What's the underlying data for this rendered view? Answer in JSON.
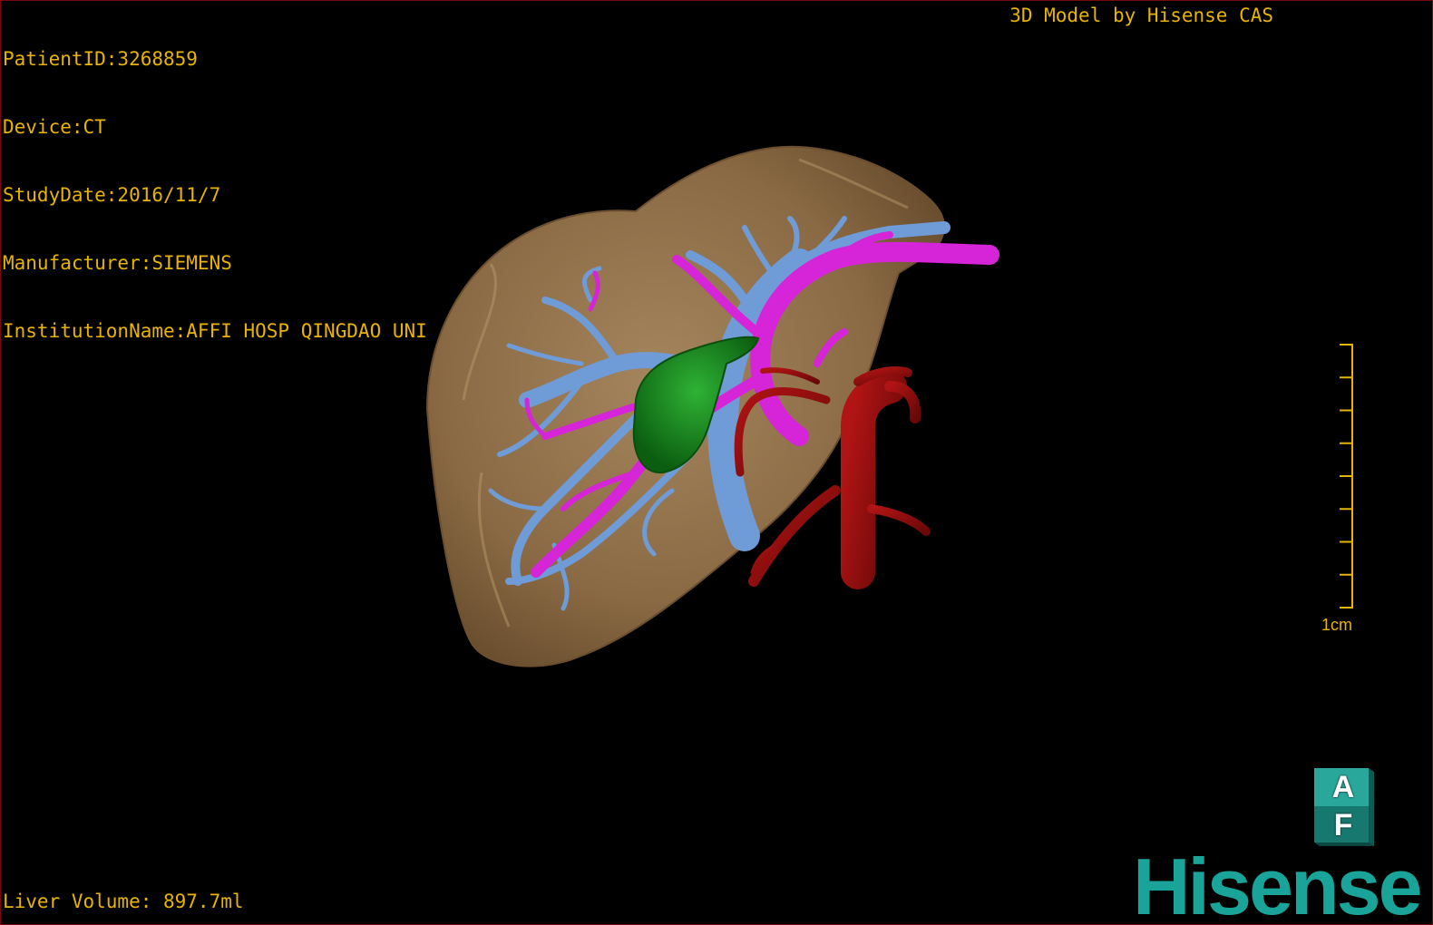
{
  "header": {
    "patient_id": "PatientID:3268859",
    "device": "Device:CT",
    "study_date": "StudyDate:2016/11/7",
    "manufacturer": "Manufacturer:SIEMENS",
    "institution": "InstitutionName:AFFI HOSP QINGDAO UNI",
    "credit": "3D Model by Hisense CAS"
  },
  "footer": {
    "liver_volume": "Liver Volume: 897.7ml"
  },
  "scale": {
    "label": "1cm",
    "tick_count": 9
  },
  "orientation": {
    "top_letter": "A",
    "front_letter": "F"
  },
  "brand": {
    "name": "Hisense"
  },
  "colors": {
    "overlay_text": "#e8b400",
    "liver": "#8a6a44",
    "portal_vein": "#6f9bd6",
    "hepatic_vein": "#d624d8",
    "gallbladder": "#13861a",
    "artery": "#8f0d0d",
    "brand": "#1aa398",
    "cube": "#1d8f86"
  },
  "icons": {
    "orientation_cube": "orientation-cube-icon"
  }
}
